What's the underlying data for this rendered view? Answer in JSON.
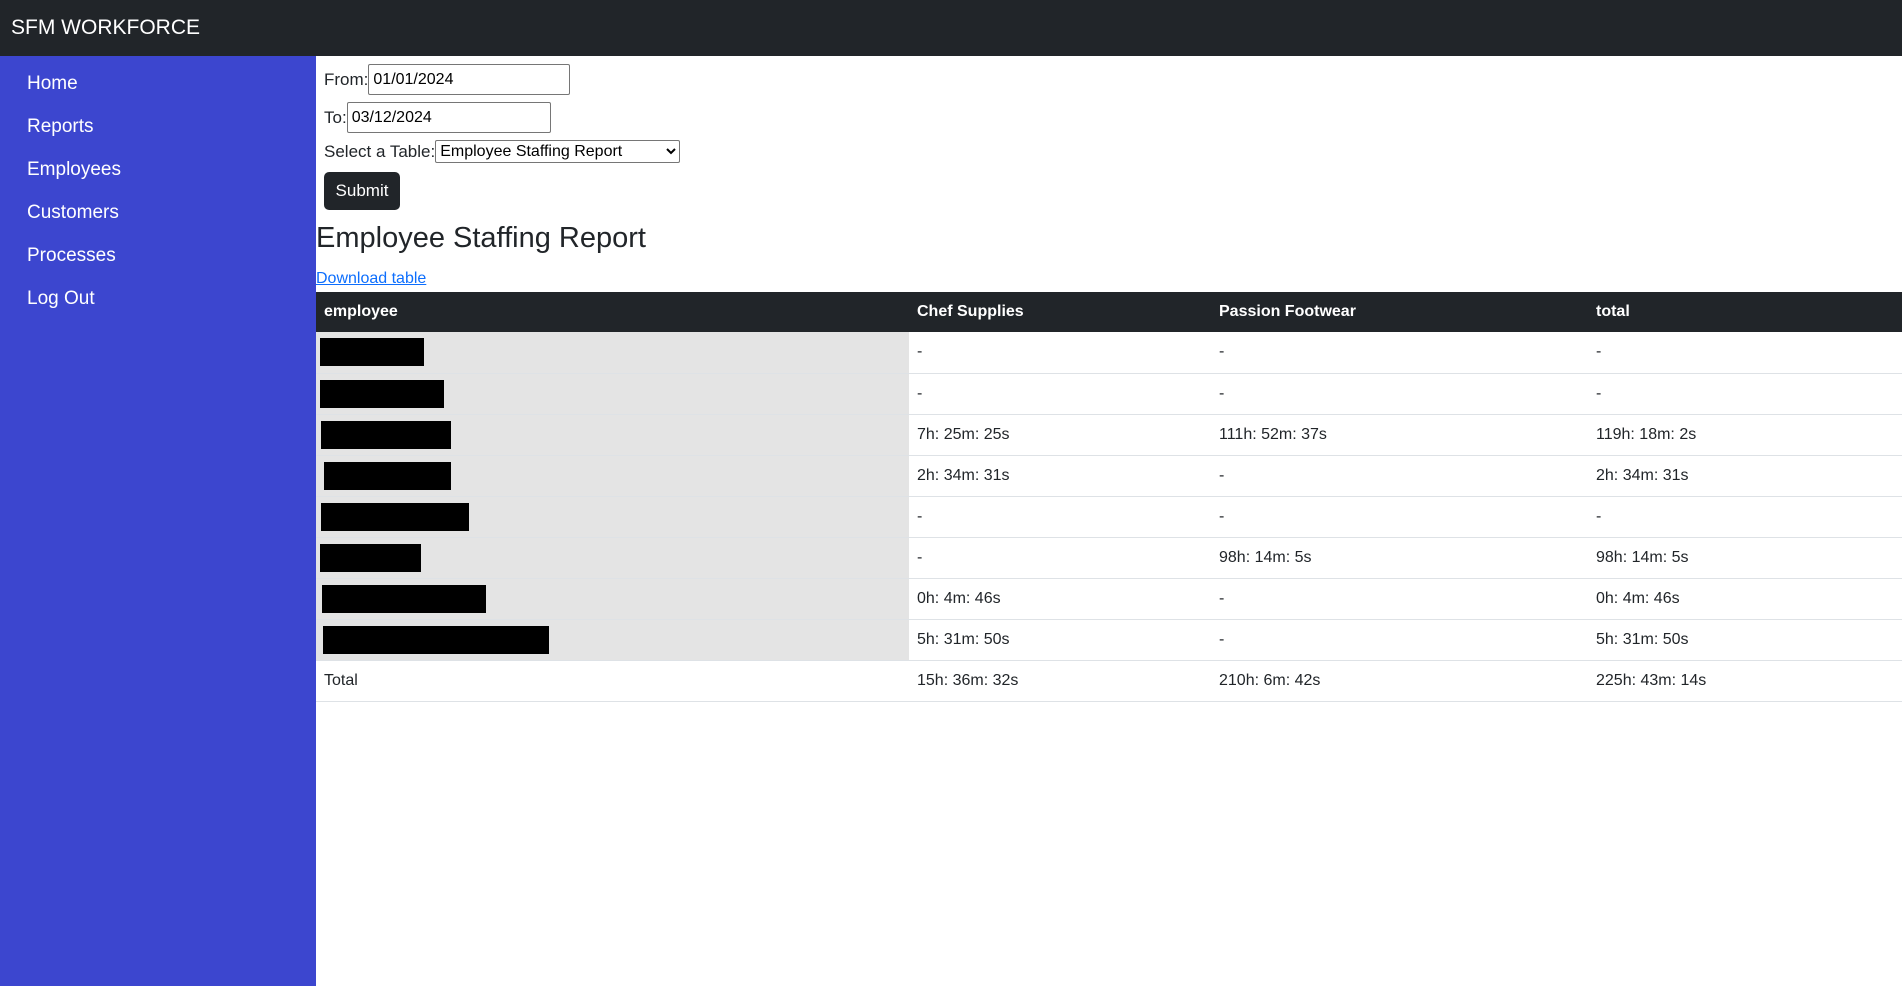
{
  "app": {
    "title": "SFM WORKFORCE"
  },
  "sidebar": {
    "items": [
      {
        "label": "Home"
      },
      {
        "label": "Reports"
      },
      {
        "label": "Employees"
      },
      {
        "label": "Customers"
      },
      {
        "label": "Processes"
      },
      {
        "label": "Log Out"
      }
    ]
  },
  "form": {
    "from_label": "From:",
    "from_value": "01/01/2024",
    "to_label": "To:",
    "to_value": "03/12/2024",
    "table_label": "Select a Table:",
    "table_selected": "Employee Staffing Report",
    "submit_label": "Submit"
  },
  "report": {
    "title": "Employee Staffing Report",
    "download_label": "Download table",
    "columns": [
      "employee",
      "Chef Supplies",
      "Passion Footwear",
      "total"
    ],
    "rows": [
      {
        "employee": "",
        "chef": "-",
        "passion": "-",
        "total": "-"
      },
      {
        "employee": "",
        "chef": "-",
        "passion": "-",
        "total": "-"
      },
      {
        "employee": "",
        "chef": "7h: 25m: 25s",
        "passion": "111h: 52m: 37s",
        "total": "119h: 18m: 2s"
      },
      {
        "employee": "",
        "chef": "2h: 34m: 31s",
        "passion": "-",
        "total": "2h: 34m: 31s"
      },
      {
        "employee": "",
        "chef": "-",
        "passion": "-",
        "total": "-"
      },
      {
        "employee": "",
        "chef": "-",
        "passion": "98h: 14m: 5s",
        "total": "98h: 14m: 5s"
      },
      {
        "employee": "",
        "chef": "0h: 4m: 46s",
        "passion": "-",
        "total": "0h: 4m: 46s"
      },
      {
        "employee": "",
        "chef": "5h: 31m: 50s",
        "passion": "-",
        "total": "5h: 31m: 50s"
      }
    ],
    "total_row": {
      "label": "Total",
      "chef": "15h: 36m: 32s",
      "passion": "210h: 6m: 42s",
      "total": "225h: 43m: 14s"
    }
  }
}
